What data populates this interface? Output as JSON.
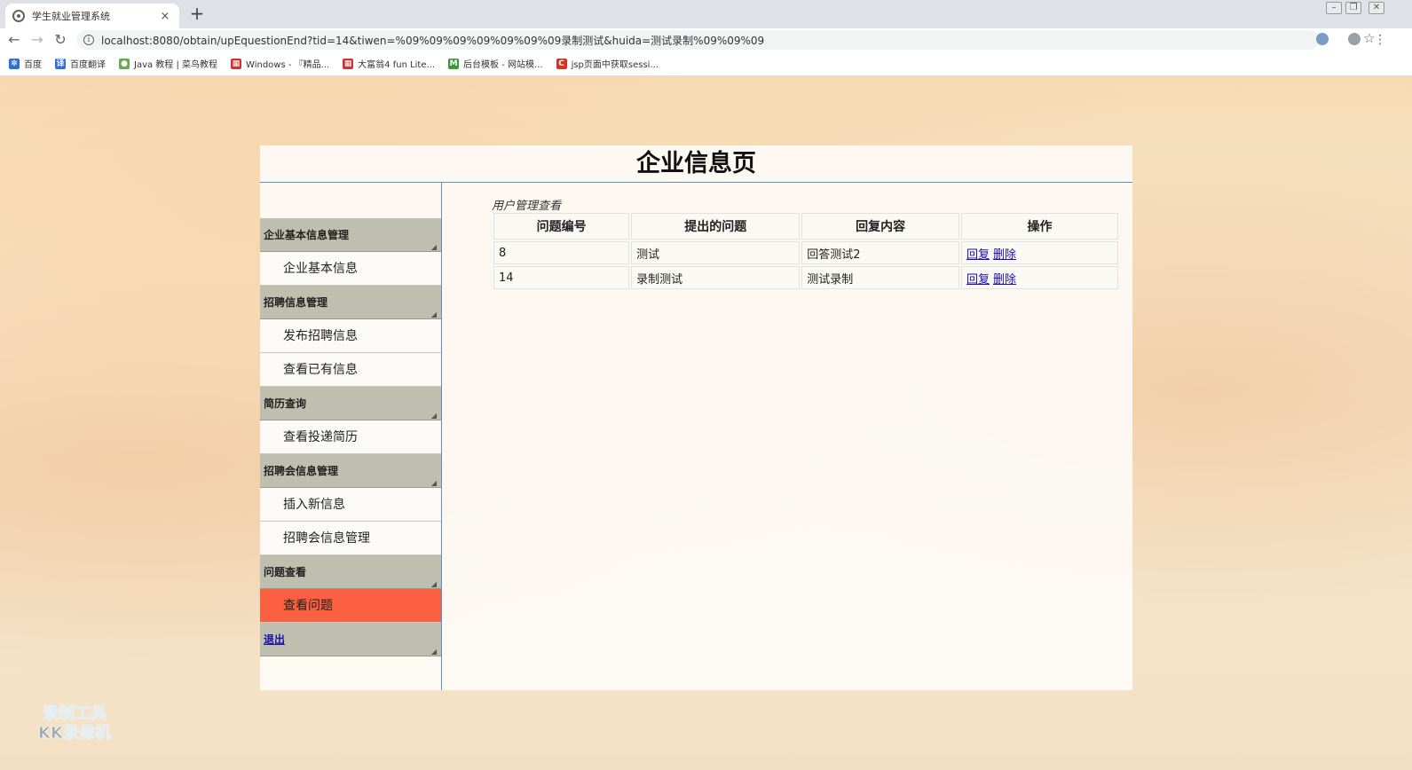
{
  "browser": {
    "tab_title": "学生就业管理系统",
    "tab_close": "×",
    "new_tab": "+",
    "url": "localhost:8080/obtain/upEquestionEnd?tid=14&tiwen=%09%09%09%09%09%09%09录制测试&huida=测试录制%09%09%09",
    "bookmarks": [
      {
        "label": "百度",
        "color": "#2f6fd6",
        "glyph": "✻"
      },
      {
        "label": "百度翻译",
        "color": "#2f6fd6",
        "glyph": "译"
      },
      {
        "label": "Java 教程 | 菜鸟教程",
        "color": "#6aa84f",
        "glyph": "●"
      },
      {
        "label": "Windows - 『精品...",
        "color": "#cc3333",
        "glyph": "▦"
      },
      {
        "label": "大富翁4 fun Lite...",
        "color": "#cc3333",
        "glyph": "▦"
      },
      {
        "label": "后台模板 - 网站模...",
        "color": "#3c9a3c",
        "glyph": "M"
      },
      {
        "label": "jsp页面中获取sessi...",
        "color": "#d93025",
        "glyph": "C"
      }
    ]
  },
  "header": {
    "title": "企业信息页"
  },
  "sidebar": {
    "groups": [
      {
        "title": "企业基本信息管理",
        "items": [
          "企业基本信息"
        ]
      },
      {
        "title": "招聘信息管理",
        "items": [
          "发布招聘信息",
          "查看已有信息"
        ]
      },
      {
        "title": "简历查询",
        "items": [
          "查看投递简历"
        ]
      },
      {
        "title": "招聘会信息管理",
        "items": [
          "插入新信息",
          "招聘会信息管理"
        ]
      },
      {
        "title": "问题查看",
        "items": [
          "查看问题"
        ]
      }
    ],
    "active_item": "查看问题",
    "logout": "退出"
  },
  "main": {
    "caption": "用户管理查看",
    "columns": [
      "问题编号",
      "提出的问题",
      "回复内容",
      "操作"
    ],
    "rows": [
      {
        "id": "8",
        "question": "测试",
        "reply": "回答测试2",
        "actions": [
          "回复",
          "删除"
        ]
      },
      {
        "id": "14",
        "question": "录制测试",
        "reply": "测试录制",
        "actions": [
          "回复",
          "删除"
        ]
      }
    ]
  },
  "watermark": {
    "line1": "录制工具",
    "line2": "KK录像机"
  }
}
